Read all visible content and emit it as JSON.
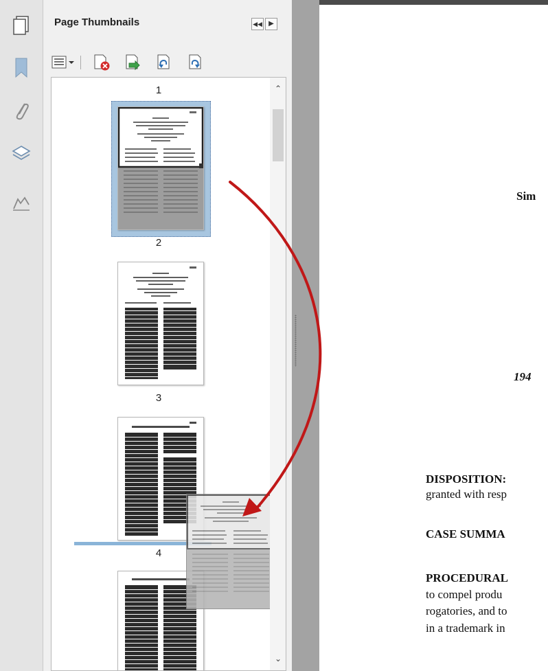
{
  "panel": {
    "title": "Page Thumbnails"
  },
  "rail": {
    "items": [
      {
        "icon": "pages-icon"
      },
      {
        "icon": "bookmark-icon"
      },
      {
        "icon": "paperclip-icon"
      },
      {
        "icon": "layers-icon"
      },
      {
        "icon": "signature-icon"
      }
    ]
  },
  "toolbar": {
    "buttons": [
      "options-menu-icon",
      "delete-pages-icon",
      "insert-pages-icon",
      "undo-icon",
      "redo-icon"
    ]
  },
  "thumbnails": {
    "labels": [
      "1",
      "2",
      "3",
      "4"
    ],
    "selected_page": "1"
  },
  "document": {
    "lines": [
      "Sim",
      "194",
      "DISPOSITION:",
      "granted with resp",
      "CASE SUMMA",
      "PROCEDURAL",
      "to compel produ",
      "rogatories, and to",
      "in a trademark in"
    ]
  },
  "colors": {
    "accent_selection": "#a8c6e0",
    "insert_marker": "#8ab4d8",
    "drag_arrow": "#c01818",
    "splitter": "#a3a3a3"
  }
}
